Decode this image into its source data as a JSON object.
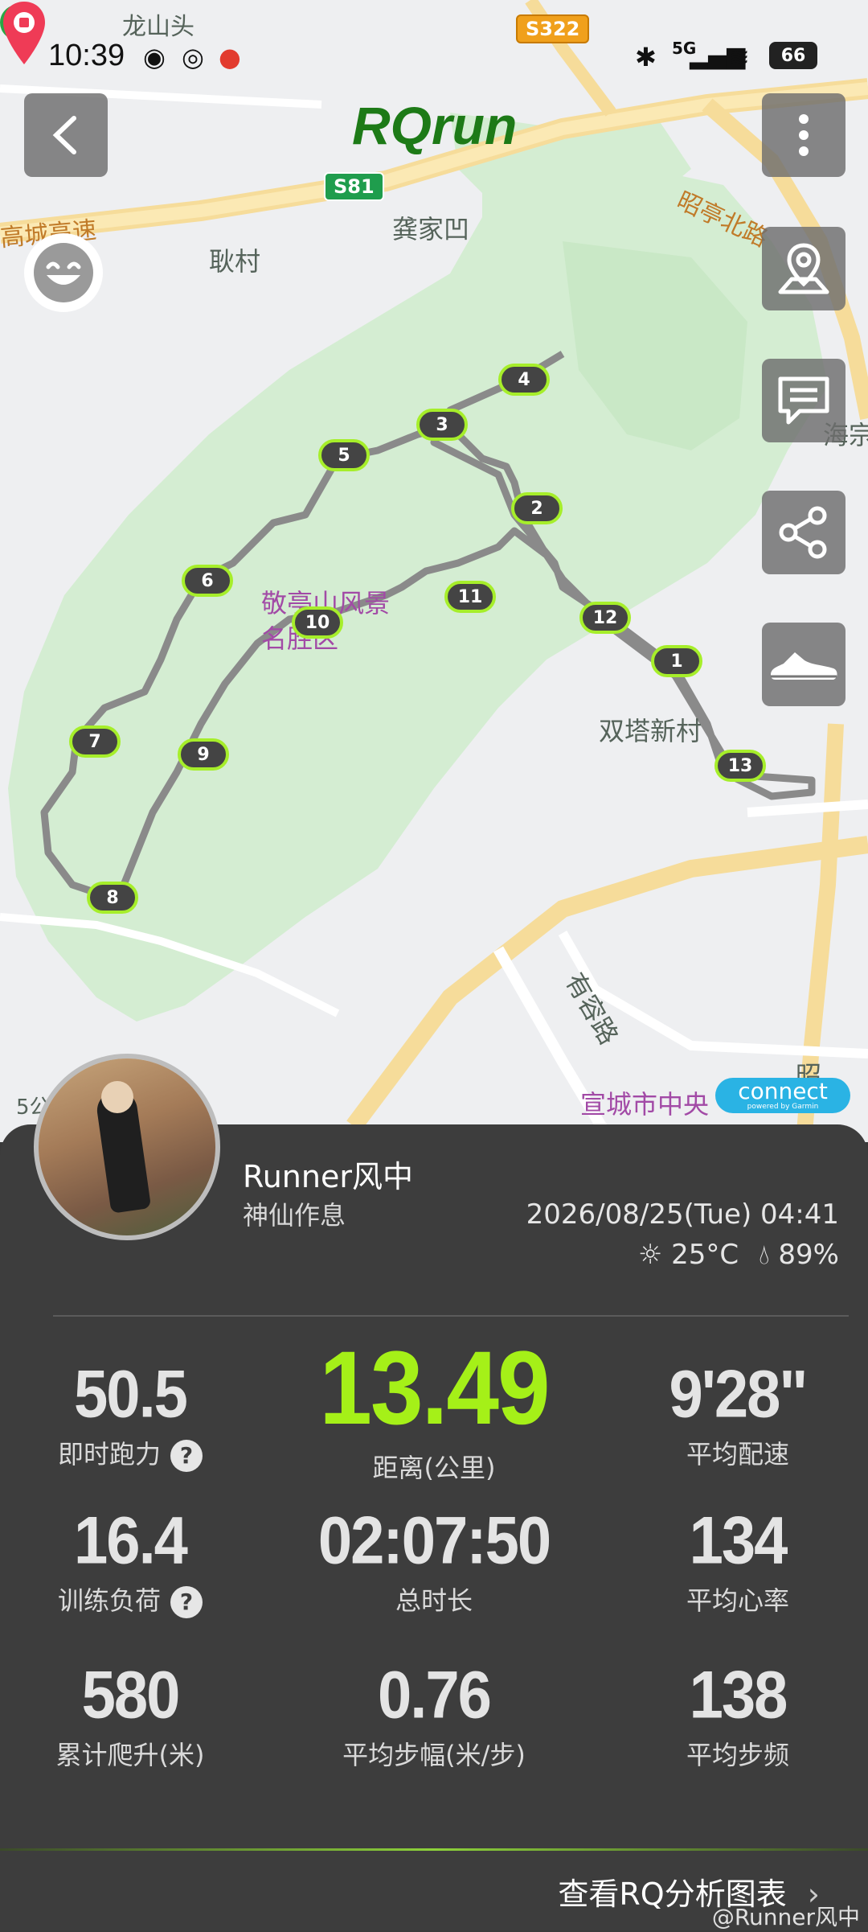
{
  "status_bar": {
    "time": "10:39",
    "battery": "66",
    "network": "5G"
  },
  "app": {
    "title": "RQrun"
  },
  "map": {
    "labels": {
      "village1": "耿村",
      "village2": "龚家凹",
      "scenic": "敬亭山风景名胜区",
      "village3": "双塔新村",
      "road1": "昭亭北路",
      "road2": "有容路",
      "road3": "高城高速",
      "place": "宣城市中央",
      "haizong": "海宗",
      "top_label": "龙山头",
      "scale": "5公",
      "zhao": "昭"
    },
    "road_badges": {
      "s322": "S322",
      "s81": "S81"
    },
    "km_markers": [
      "1",
      "2",
      "3",
      "4",
      "5",
      "6",
      "7",
      "8",
      "9",
      "10",
      "11",
      "12",
      "13"
    ],
    "connect": {
      "label": "connect",
      "sub": "powered by Garmin"
    }
  },
  "user": {
    "name": "Runner风中",
    "subtitle": "神仙作息",
    "datetime": "2026/08/25(Tue) 04:41",
    "temperature": "25°C",
    "humidity": "89%"
  },
  "stats": {
    "running_power": {
      "value": "50.5",
      "label": "即时跑力"
    },
    "distance": {
      "value": "13.49",
      "label": "距离(公里)"
    },
    "avg_pace": {
      "value": "9'28\"",
      "label": "平均配速"
    },
    "training_load": {
      "value": "16.4",
      "label": "训练负荷"
    },
    "duration": {
      "value": "02:07:50",
      "label": "总时长"
    },
    "avg_hr": {
      "value": "134",
      "label": "平均心率"
    },
    "elevation": {
      "value": "580",
      "label": "累计爬升(米)"
    },
    "stride": {
      "value": "0.76",
      "label": "平均步幅(米/步)"
    },
    "cadence": {
      "value": "138",
      "label": "平均步频"
    },
    "help_mark": "?"
  },
  "footer": {
    "view_chart": "查看RQ分析图表",
    "watermark": "@Runner风中"
  },
  "colors": {
    "accent_green": "#a5f018",
    "panel_bg": "#3d3d3d",
    "title_green": "#1d7a17"
  },
  "icons": [
    "back-arrow-icon",
    "more-icon",
    "map-pin-icon",
    "comment-icon",
    "share-icon",
    "shoe-icon",
    "emoji-icon",
    "sun-icon",
    "droplet-icon",
    "question-icon",
    "chevron-right-icon"
  ]
}
